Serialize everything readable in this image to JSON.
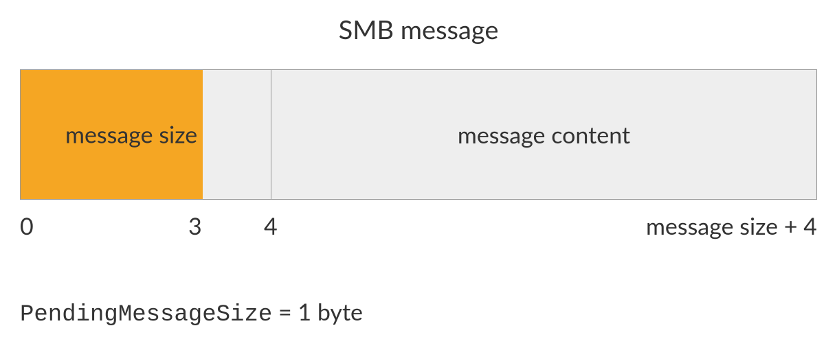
{
  "title": "SMB message",
  "segments": {
    "size_label": "message size",
    "content_label": "message content"
  },
  "ticks": {
    "t0": "0",
    "t3": "3",
    "t4": "4",
    "tend": "message size + 4"
  },
  "footer": {
    "variable": "PendingMessageSize",
    "equals": " = 1 byte"
  }
}
